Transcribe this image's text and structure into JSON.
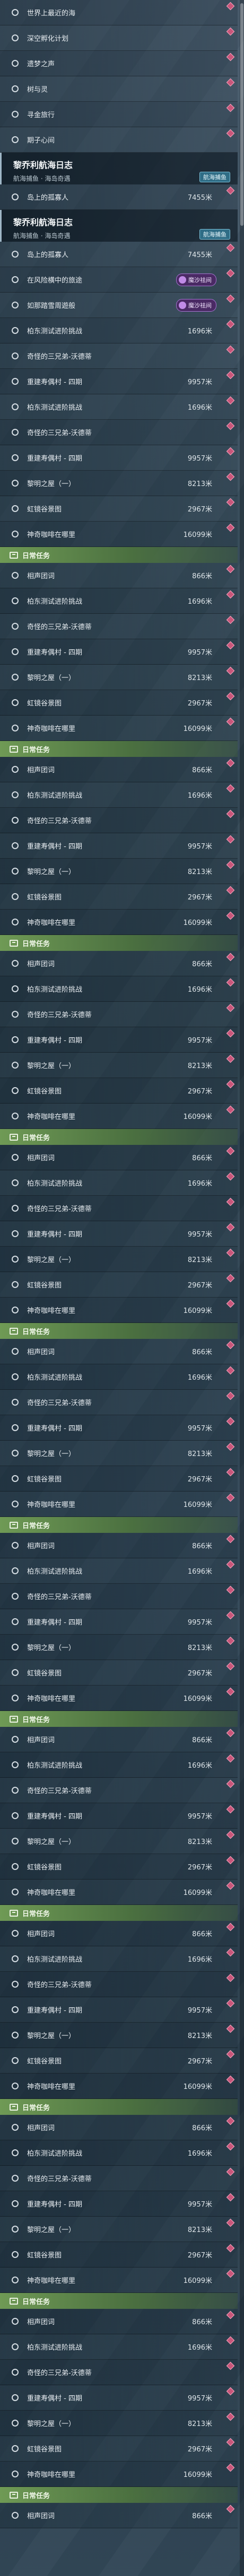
{
  "top_list": [
    {
      "label": "世界上最近的海",
      "dist": ""
    },
    {
      "label": "深空孵化计划",
      "dist": ""
    },
    {
      "label": "遗梦之声",
      "dist": ""
    },
    {
      "label": "树与灵",
      "dist": ""
    },
    {
      "label": "寻金旅行",
      "dist": ""
    },
    {
      "label": "期子心间",
      "dist": ""
    }
  ],
  "log1": {
    "title": "黎乔利航海日志",
    "subtitle": "航海捕鱼 · 海岛奇遇",
    "tag": "航海捕鱼"
  },
  "log1_rows": [
    {
      "label": "岛上的孤寡人",
      "dist": "7455米"
    }
  ],
  "log2": {
    "title": "黎乔利航海日志",
    "subtitle": "航海捕鱼 · 海岛奇遇",
    "tag": "航海捕鱼"
  },
  "log2_rows": [
    {
      "label": "岛上的孤寡人",
      "dist": "7455米"
    },
    {
      "label": "在风险横中的旅途",
      "pill": "魔沙祛间"
    },
    {
      "label": "如那踏雪周遊般",
      "pill": "魔沙祛间"
    },
    {
      "label": "柏东测试进阶挑战",
      "dist": "1696米"
    },
    {
      "label": "奇怪的三兄弟-沃德蒂",
      "dist": ""
    },
    {
      "label": "重建寿偶村 - 四期",
      "dist": "9957米"
    }
  ],
  "block": [
    {
      "label": "柏东测试进阶挑战",
      "dist": "1696米"
    },
    {
      "label": "奇怪的三兄弟-沃德蒂",
      "dist": ""
    },
    {
      "label": "重建寿偶村 - 四期",
      "dist": "9957米"
    },
    {
      "label": "黎明之屋（一）",
      "dist": "8213米"
    },
    {
      "label": "虹镜谷景图",
      "dist": "2967米"
    },
    {
      "label": "神奇咖啡在哪里",
      "dist": "16099米"
    }
  ],
  "daily": {
    "label": "日常任务",
    "item": "相声团词",
    "dist": "866米"
  }
}
